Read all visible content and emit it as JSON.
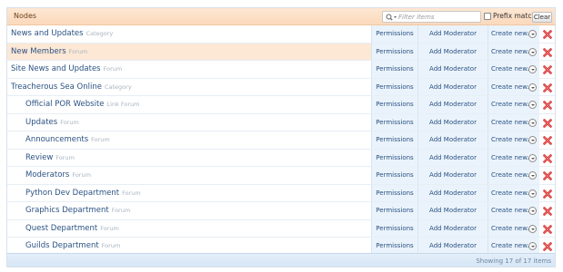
{
  "header": {
    "title": "Nodes",
    "filter_placeholder": "Filter items",
    "prefix_label": "Prefix match",
    "clear_label": "Clear"
  },
  "actions": {
    "permissions": "Permissions",
    "add_moderator": "Add Moderator",
    "create_new": "Create new..."
  },
  "nodes": [
    {
      "name": "News and Updates",
      "type": "Category",
      "indent": 0
    },
    {
      "name": "New Members",
      "type": "Forum",
      "indent": 0,
      "highlighted": true
    },
    {
      "name": "Site News and Updates",
      "type": "Forum",
      "indent": 0
    },
    {
      "name": "Treacherous Sea Online",
      "type": "Category",
      "indent": 0
    },
    {
      "name": "Official POR Website",
      "type": "Link Forum",
      "indent": 1
    },
    {
      "name": "Updates",
      "type": "Forum",
      "indent": 1
    },
    {
      "name": "Announcements",
      "type": "Forum",
      "indent": 1
    },
    {
      "name": "Review",
      "type": "Forum",
      "indent": 1
    },
    {
      "name": "Moderators",
      "type": "Forum",
      "indent": 1
    },
    {
      "name": "Python Dev Department",
      "type": "Forum",
      "indent": 1
    },
    {
      "name": "Graphics Department",
      "type": "Forum",
      "indent": 1
    },
    {
      "name": "Quest Department",
      "type": "Forum",
      "indent": 1
    },
    {
      "name": "Guilds Department",
      "type": "Forum",
      "indent": 1
    }
  ],
  "footer": {
    "status": "Showing 17 of 17 items"
  },
  "icons": {
    "filter": "magnifier-dropdown-icon",
    "delete": "red-x-delete-icon",
    "dropdown": "chevron-down-icon"
  },
  "colors": {
    "link": "#2b5283",
    "header_bg": "#fbd9bb",
    "highlight_row": "#fde8d6",
    "action_bg": "#eaf3fb",
    "delete": "#d42a2a"
  }
}
